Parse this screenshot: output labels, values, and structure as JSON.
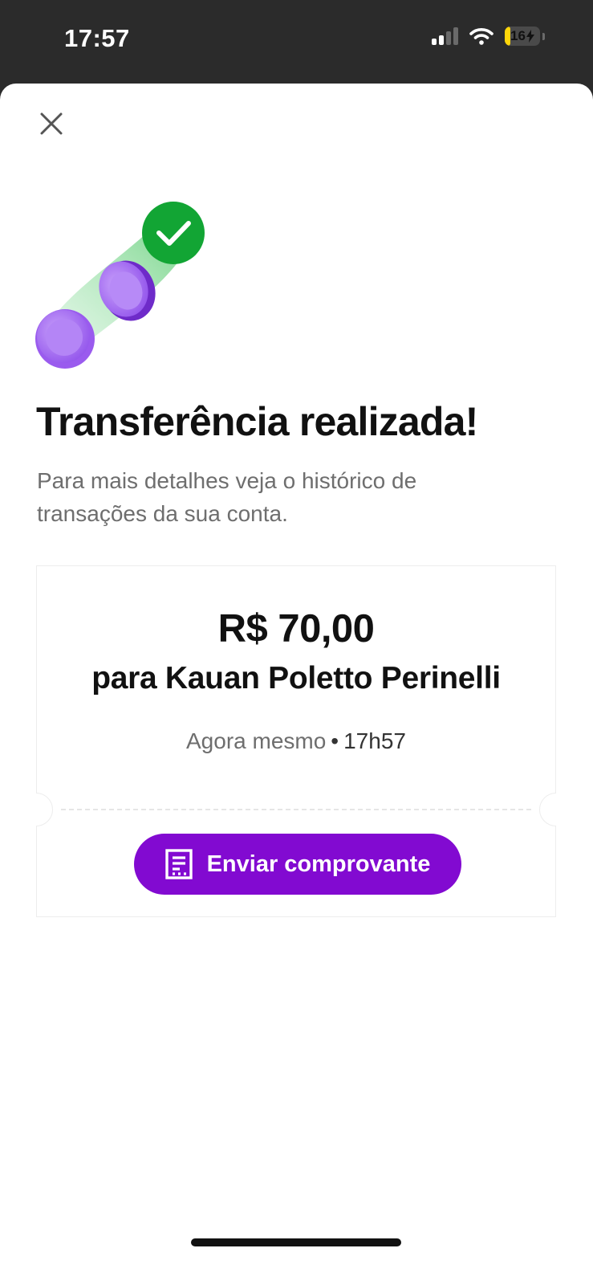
{
  "status_bar": {
    "time": "17:57",
    "battery_level": "16",
    "icons": [
      "cellular-signal-icon",
      "wifi-icon",
      "battery-charging-icon"
    ]
  },
  "header": {
    "close_icon": "close-icon"
  },
  "success": {
    "title": "Transferência realizada!",
    "subtitle": "Para mais detalhes veja o histórico de transações da sua conta.",
    "illustration_icon": "check-coins-icon"
  },
  "receipt": {
    "amount": "R$ 70,00",
    "recipient": "para Kauan Poletto Perinelli",
    "time_relative": "Agora mesmo",
    "time_separator": "•",
    "time_exact": "17h57",
    "send_button_label": "Enviar comprovante",
    "send_button_icon": "receipt-icon"
  },
  "colors": {
    "accent": "#820ad1",
    "success": "#12a534",
    "coin": "#a86ef0"
  }
}
